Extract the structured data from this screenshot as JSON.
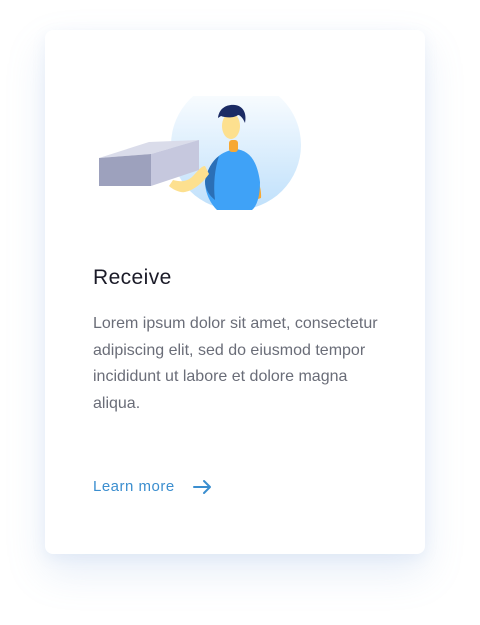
{
  "card": {
    "title": "Receive",
    "description": "Lorem ipsum dolor sit amet, consectetur adipiscing elit, sed do eiusmod tempor incididunt ut labore et dolore magna aliqua.",
    "link_label": "Learn more",
    "link_icon": "arrow-right-icon",
    "illustration": "person-holding-box"
  },
  "colors": {
    "link": "#3b8ecf",
    "title": "#1b1b28",
    "text": "#6a6d78",
    "shirt": "#3fa2f7",
    "accent": "#f7a833"
  }
}
